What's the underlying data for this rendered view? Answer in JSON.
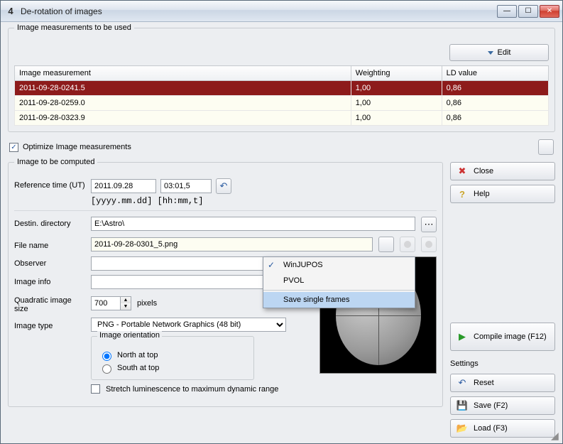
{
  "window": {
    "title": "De-rotation of images"
  },
  "group1": {
    "title": "Image measurements to be used",
    "edit_label": "Edit",
    "headers": {
      "measurement": "Image measurement",
      "weighting": "Weighting",
      "ld": "LD value"
    },
    "rows": [
      {
        "name": "2011-09-28-0241.5",
        "w": "1,00",
        "ld": "0,86",
        "selected": true
      },
      {
        "name": "2011-09-28-0259.0",
        "w": "1,00",
        "ld": "0,86",
        "selected": false
      },
      {
        "name": "2011-09-28-0323.9",
        "w": "1,00",
        "ld": "0,86",
        "selected": false
      }
    ],
    "optimize_label": "Optimize Image measurements",
    "optimize_checked": true
  },
  "group2": {
    "title": "Image to be computed",
    "ref_label": "Reference time (UT)",
    "ref_date": "2011.09.28",
    "ref_time": "03:01,5",
    "ref_hint": "[yyyy.mm.dd] [hh:mm,t]",
    "dir_label": "Destin. directory",
    "dir_value": "E:\\Astro\\",
    "file_label": "File name",
    "file_value": "2011-09-28-0301_5.png",
    "observer_label": "Observer",
    "observer_value": "",
    "info_label": "Image info",
    "info_value": "",
    "size_label": "Quadratic image size",
    "size_value": "700",
    "size_unit": "pixels",
    "type_label": "Image type",
    "type_value": "PNG  - Portable Network Graphics (48 bit)",
    "orient_title": "Image orientation",
    "orient_north": "North at top",
    "orient_south": "South at top",
    "stretch_label": "Stretch luminescence to maximum dynamic range",
    "stretch_checked": false
  },
  "menu": {
    "item1": "WinJUPOS",
    "item2": "PVOL",
    "item3": "Save single frames"
  },
  "sidebar": {
    "close": "Close",
    "help": "Help",
    "compile": "Compile image (F12)",
    "settings_label": "Settings",
    "reset": "Reset",
    "save": "Save (F2)",
    "load": "Load (F3)"
  }
}
